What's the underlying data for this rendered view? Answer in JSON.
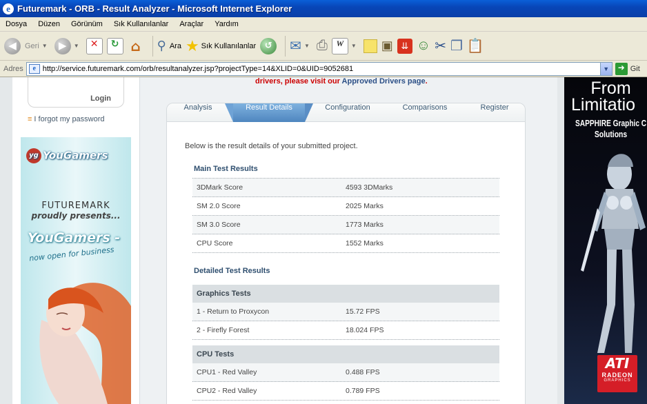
{
  "window": {
    "title": "Futuremark - ORB - Result Analyzer - Microsoft Internet Explorer"
  },
  "menu": [
    "Dosya",
    "Düzen",
    "Görünüm",
    "Sık Kullanılanlar",
    "Araçlar",
    "Yardım"
  ],
  "toolbar": {
    "back_label": "Geri",
    "search_label": "Ara",
    "favorites_label": "Sık Kullanılanlar"
  },
  "address": {
    "label": "Adres",
    "url": "http://service.futuremark.com/orb/resultanalyzer.jsp?projectType=14&XLID=0&UID=9052681",
    "go_label": "Git"
  },
  "sidebar": {
    "login_label": "Login",
    "forgot_label": "I forgot my password"
  },
  "ad_left": {
    "logo": "YouGamers",
    "line1": "FUTUREMARK",
    "line2": "proudly presents...",
    "line3": "YouGamers -",
    "line4": "now open for business"
  },
  "ad_right": {
    "line1": "From",
    "line2": "Limitatio",
    "line3": "SAPPHIRE Graphic C",
    "line4": "Solutions",
    "brand": "ATI",
    "brand2": "RADEON",
    "brand3": "GRAPHICS"
  },
  "notice": {
    "text": "drivers, please visit our ",
    "link": "Approved Drivers page",
    "end": "."
  },
  "tabs": [
    "Analysis",
    "Result Details",
    "Configuration",
    "Comparisons",
    "Register"
  ],
  "intro": "Below is the result details of your submitted project.",
  "main_results": {
    "title": "Main Test Results",
    "rows": [
      {
        "name": "3DMark Score",
        "value": "4593 3DMarks"
      },
      {
        "name": "SM 2.0 Score",
        "value": "2025 Marks"
      },
      {
        "name": "SM 3.0 Score",
        "value": "1773 Marks"
      },
      {
        "name": "CPU Score",
        "value": "1552 Marks"
      }
    ]
  },
  "detailed": {
    "title": "Detailed Test Results",
    "graphics_title": "Graphics Tests",
    "graphics": [
      {
        "name": "1 - Return to Proxycon",
        "value": "15.72 FPS"
      },
      {
        "name": "2 - Firefly Forest",
        "value": "18.024 FPS"
      }
    ],
    "cpu_title": "CPU Tests",
    "cpu": [
      {
        "name": "CPU1 - Red Valley",
        "value": "0.488 FPS"
      },
      {
        "name": "CPU2 - Red Valley",
        "value": "0.789 FPS"
      }
    ]
  }
}
